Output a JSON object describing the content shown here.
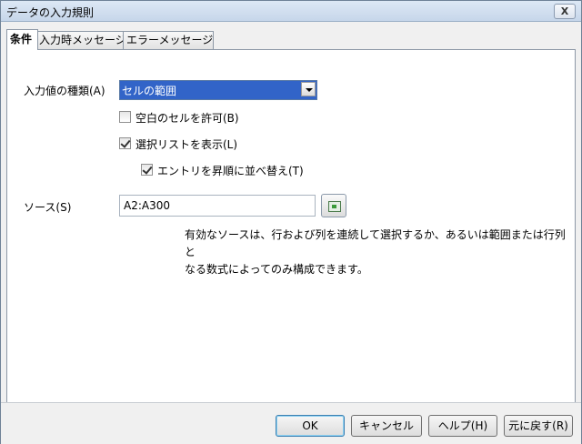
{
  "window": {
    "title": "データの入力規則",
    "close_glyph": "X"
  },
  "tabs": [
    {
      "label": "条件"
    },
    {
      "label": "入力時メッセージ"
    },
    {
      "label": "エラーメッセージ"
    }
  ],
  "criteria": {
    "allow_label": "入力値の種類(A)",
    "allow_value": "セルの範囲",
    "allow_blank": {
      "label": "空白のセルを許可(B)",
      "checked": false
    },
    "show_list": {
      "label": "選択リストを表示(L)",
      "checked": true
    },
    "sort_entries": {
      "label": "エントリを昇順に並べ替え(T)",
      "checked": true
    },
    "source_label": "ソース(S)",
    "source_value": "A2:A300",
    "help_line1": "有効なソースは、行および列を連続して選択するか、あるいは範囲または行列と",
    "help_line2": "なる数式によってのみ構成できます。"
  },
  "buttons": {
    "ok": "OK",
    "cancel": "キャンセル",
    "help": "ヘルプ(H)",
    "reset": "元に戻す(R)"
  },
  "colors": {
    "selection": "#3264c8",
    "title_bar": "#c6d6ea"
  }
}
